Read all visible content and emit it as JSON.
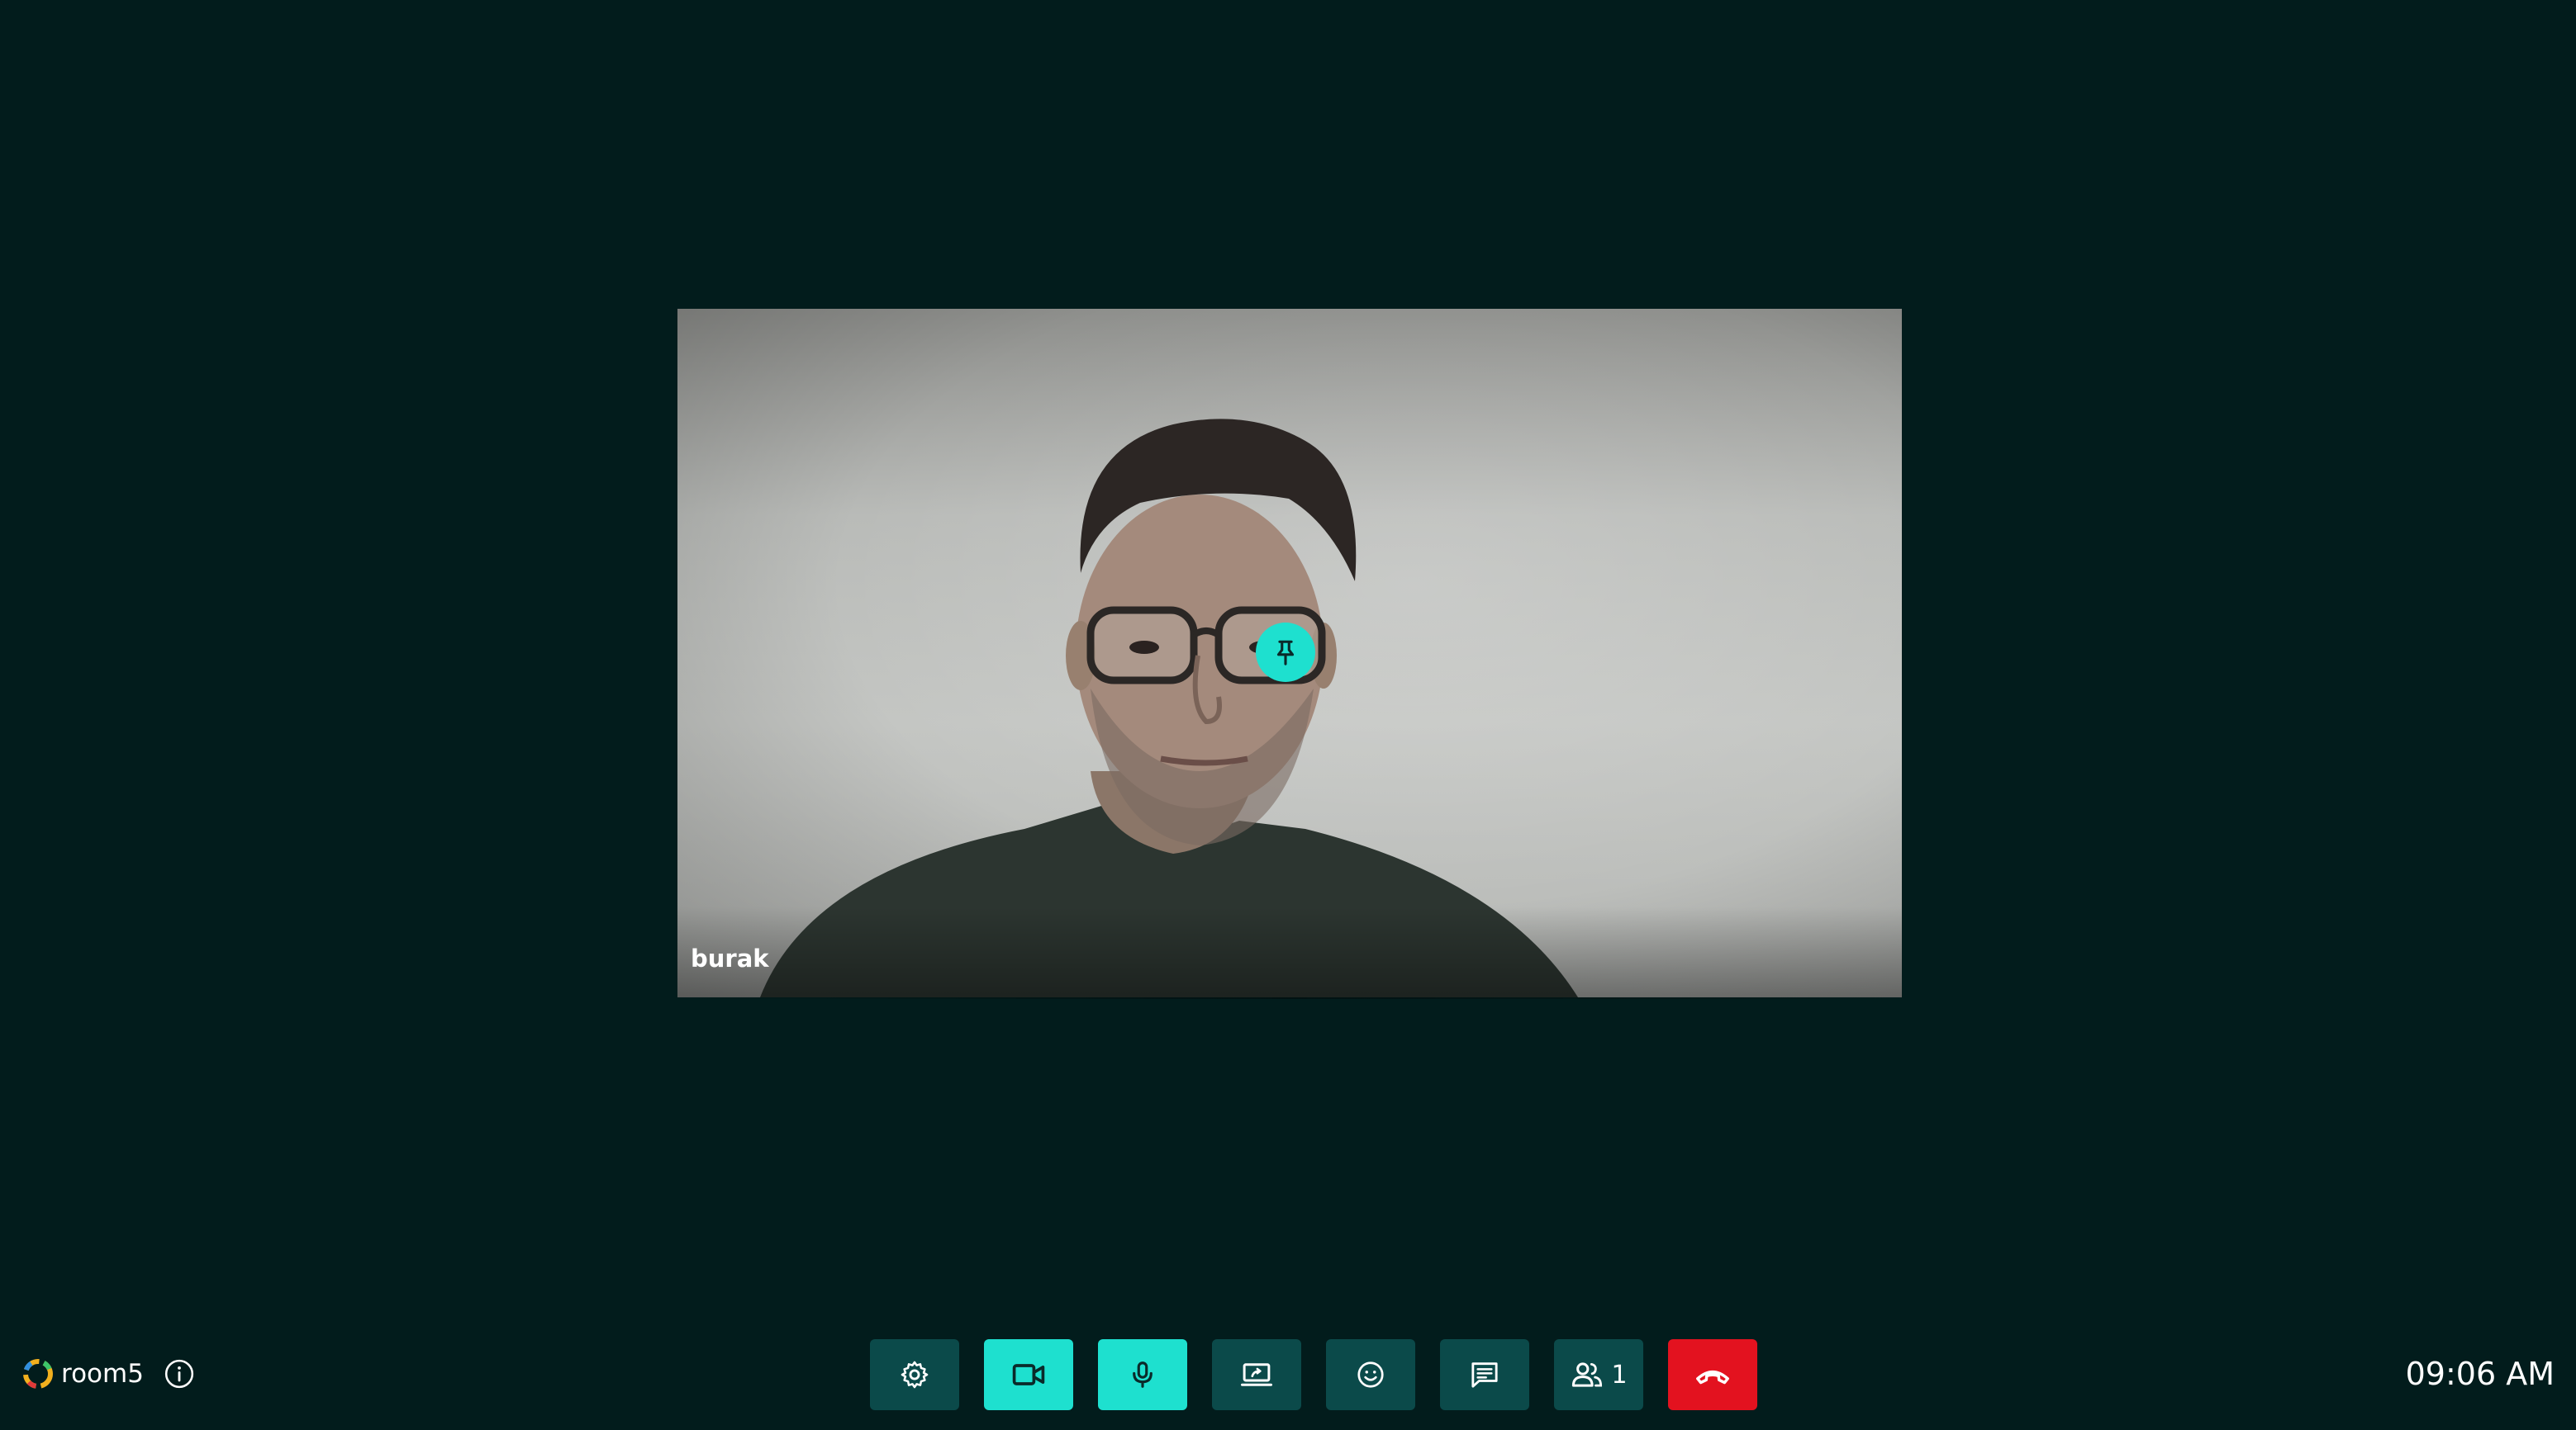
{
  "participant": {
    "name": "burak"
  },
  "room": {
    "name": "room5"
  },
  "toolbar": {
    "participants_count": "1"
  },
  "clock": {
    "time": "09:06 AM"
  },
  "colors": {
    "background": "#021c1c",
    "button": "#0b4a4a",
    "button_active": "#1ee0cf",
    "button_danger": "#e3121f"
  },
  "icons": {
    "settings": "gear-icon",
    "camera": "video-camera-icon",
    "microphone": "microphone-icon",
    "screen_share": "screen-share-icon",
    "reactions": "smiley-icon",
    "chat": "chat-icon",
    "participants": "participants-icon",
    "hangup": "hangup-phone-icon",
    "pin": "pin-icon",
    "info": "info-icon"
  }
}
